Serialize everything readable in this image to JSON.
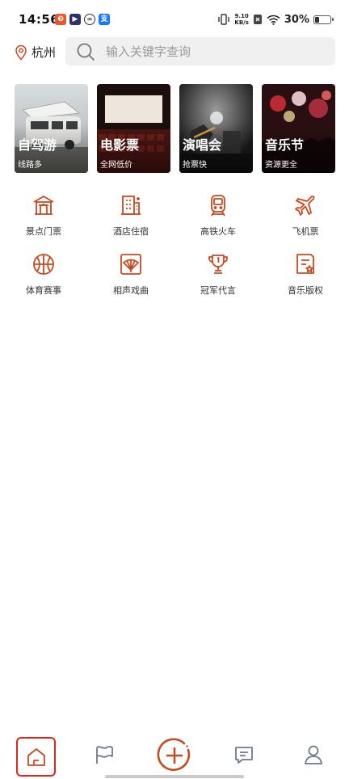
{
  "status_bar": {
    "time": "14:56",
    "notification_icons": [
      "app-badge-icon",
      "video-app-icon",
      "link-app-icon",
      "alipay-icon"
    ],
    "net_speed_value": "9.10",
    "net_speed_unit": "KB/s",
    "battery": "30%",
    "battery_level": 0.3
  },
  "header": {
    "location": "杭州",
    "search_placeholder": "输入关键字查询"
  },
  "cards": [
    {
      "title": "自驾游",
      "subtitle": "线路多"
    },
    {
      "title": "电影票",
      "subtitle": "全网低价"
    },
    {
      "title": "演唱会",
      "subtitle": "抢票快"
    },
    {
      "title": "音乐节",
      "subtitle": "资源更全"
    }
  ],
  "categories": [
    {
      "label": "景点门票",
      "icon": "scenic-gate-icon"
    },
    {
      "label": "酒店住宿",
      "icon": "hotel-icon"
    },
    {
      "label": "高铁火车",
      "icon": "train-icon"
    },
    {
      "label": "飞机票",
      "icon": "airplane-icon"
    },
    {
      "label": "体育赛事",
      "icon": "basketball-icon"
    },
    {
      "label": "相声戏曲",
      "icon": "fan-icon"
    },
    {
      "label": "冠军代言",
      "icon": "trophy-icon"
    },
    {
      "label": "音乐版权",
      "icon": "certificate-icon"
    }
  ],
  "bottom_nav": {
    "items": [
      "home-icon",
      "flag-icon",
      "add-icon",
      "message-icon",
      "user-icon"
    ],
    "active": "home-icon"
  },
  "colors": {
    "accent": "#c8491f",
    "active_outline": "#e0251b",
    "search_bg": "#f0f0f0"
  }
}
